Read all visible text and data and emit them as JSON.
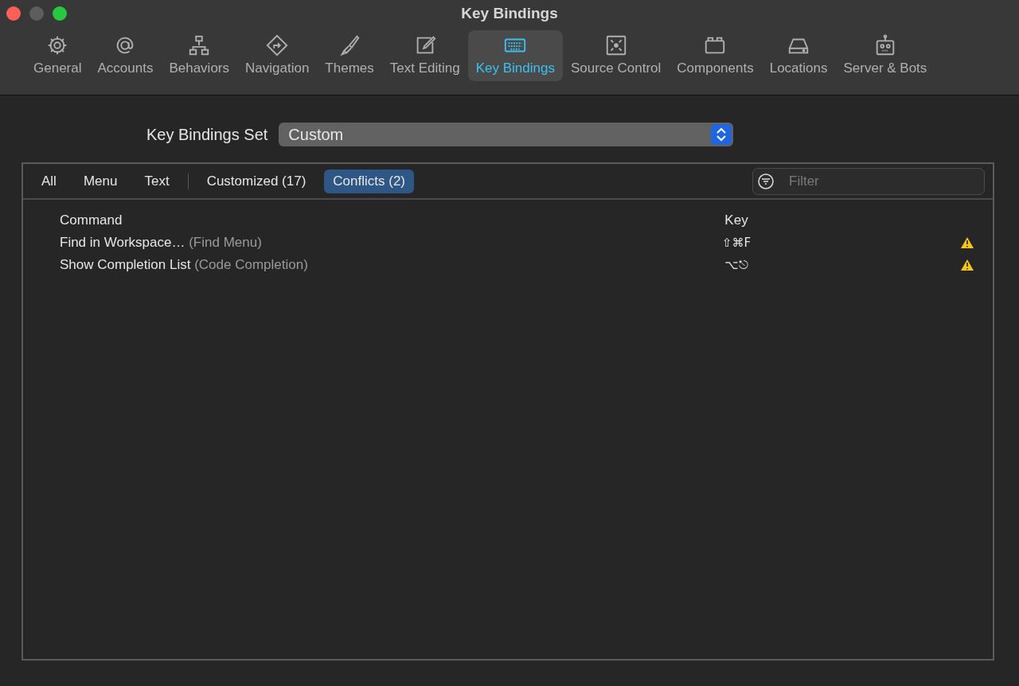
{
  "window": {
    "title": "Key Bindings"
  },
  "toolbar": [
    {
      "label": "General",
      "selected": false
    },
    {
      "label": "Accounts",
      "selected": false
    },
    {
      "label": "Behaviors",
      "selected": false
    },
    {
      "label": "Navigation",
      "selected": false
    },
    {
      "label": "Themes",
      "selected": false
    },
    {
      "label": "Text Editing",
      "selected": false
    },
    {
      "label": "Key Bindings",
      "selected": true
    },
    {
      "label": "Source Control",
      "selected": false
    },
    {
      "label": "Components",
      "selected": false
    },
    {
      "label": "Locations",
      "selected": false
    },
    {
      "label": "Server & Bots",
      "selected": false
    }
  ],
  "key_bindings_set": {
    "label": "Key Bindings Set",
    "value": "Custom"
  },
  "filters": [
    {
      "label": "All",
      "selected": false
    },
    {
      "label": "Menu",
      "selected": false
    },
    {
      "label": "Text",
      "selected": false
    },
    {
      "label": "Customized (17)",
      "selected": false
    },
    {
      "label": "Conflicts (2)",
      "selected": true
    }
  ],
  "search": {
    "placeholder": "Filter"
  },
  "table": {
    "columns": [
      "Command",
      "Key"
    ],
    "rows": [
      {
        "command": "Find in Workspace…",
        "context": "(Find Menu)",
        "key": "⇧⌘F",
        "conflict": true
      },
      {
        "command": "Show Completion List",
        "context": "(Code Completion)",
        "key": "⌥⎋",
        "conflict": true
      }
    ]
  }
}
